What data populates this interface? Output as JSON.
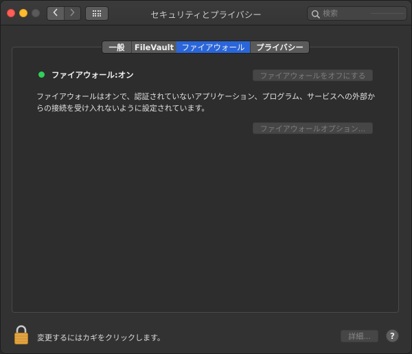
{
  "window": {
    "title": "セキュリティとプライバシー"
  },
  "toolbar": {
    "back_icon": "‹",
    "forward_icon": "›"
  },
  "search": {
    "placeholder": "検索"
  },
  "tabs": [
    {
      "label": "一般",
      "selected": false
    },
    {
      "label": "FileVault",
      "selected": false
    },
    {
      "label": "ファイアウォール",
      "selected": true
    },
    {
      "label": "プライバシー",
      "selected": false
    }
  ],
  "firewall": {
    "status_label": "ファイアウォール:オン",
    "status_color": "#2fd158",
    "turn_off_button": "ファイアウォールをオフにする",
    "description": "ファイアウォールはオンで、認証されていないアプリケーション、プログラム、サービスへの外部からの接続を受け入れないように設定されています。",
    "options_button": "ファイアウォールオプション..."
  },
  "footer": {
    "lock_text": "変更するにはカギをクリックします。",
    "details_button": "詳細...",
    "help_label": "?"
  },
  "colors": {
    "accent": "#2a66d9",
    "close": "#fe5f57",
    "minimize": "#febc2e"
  }
}
